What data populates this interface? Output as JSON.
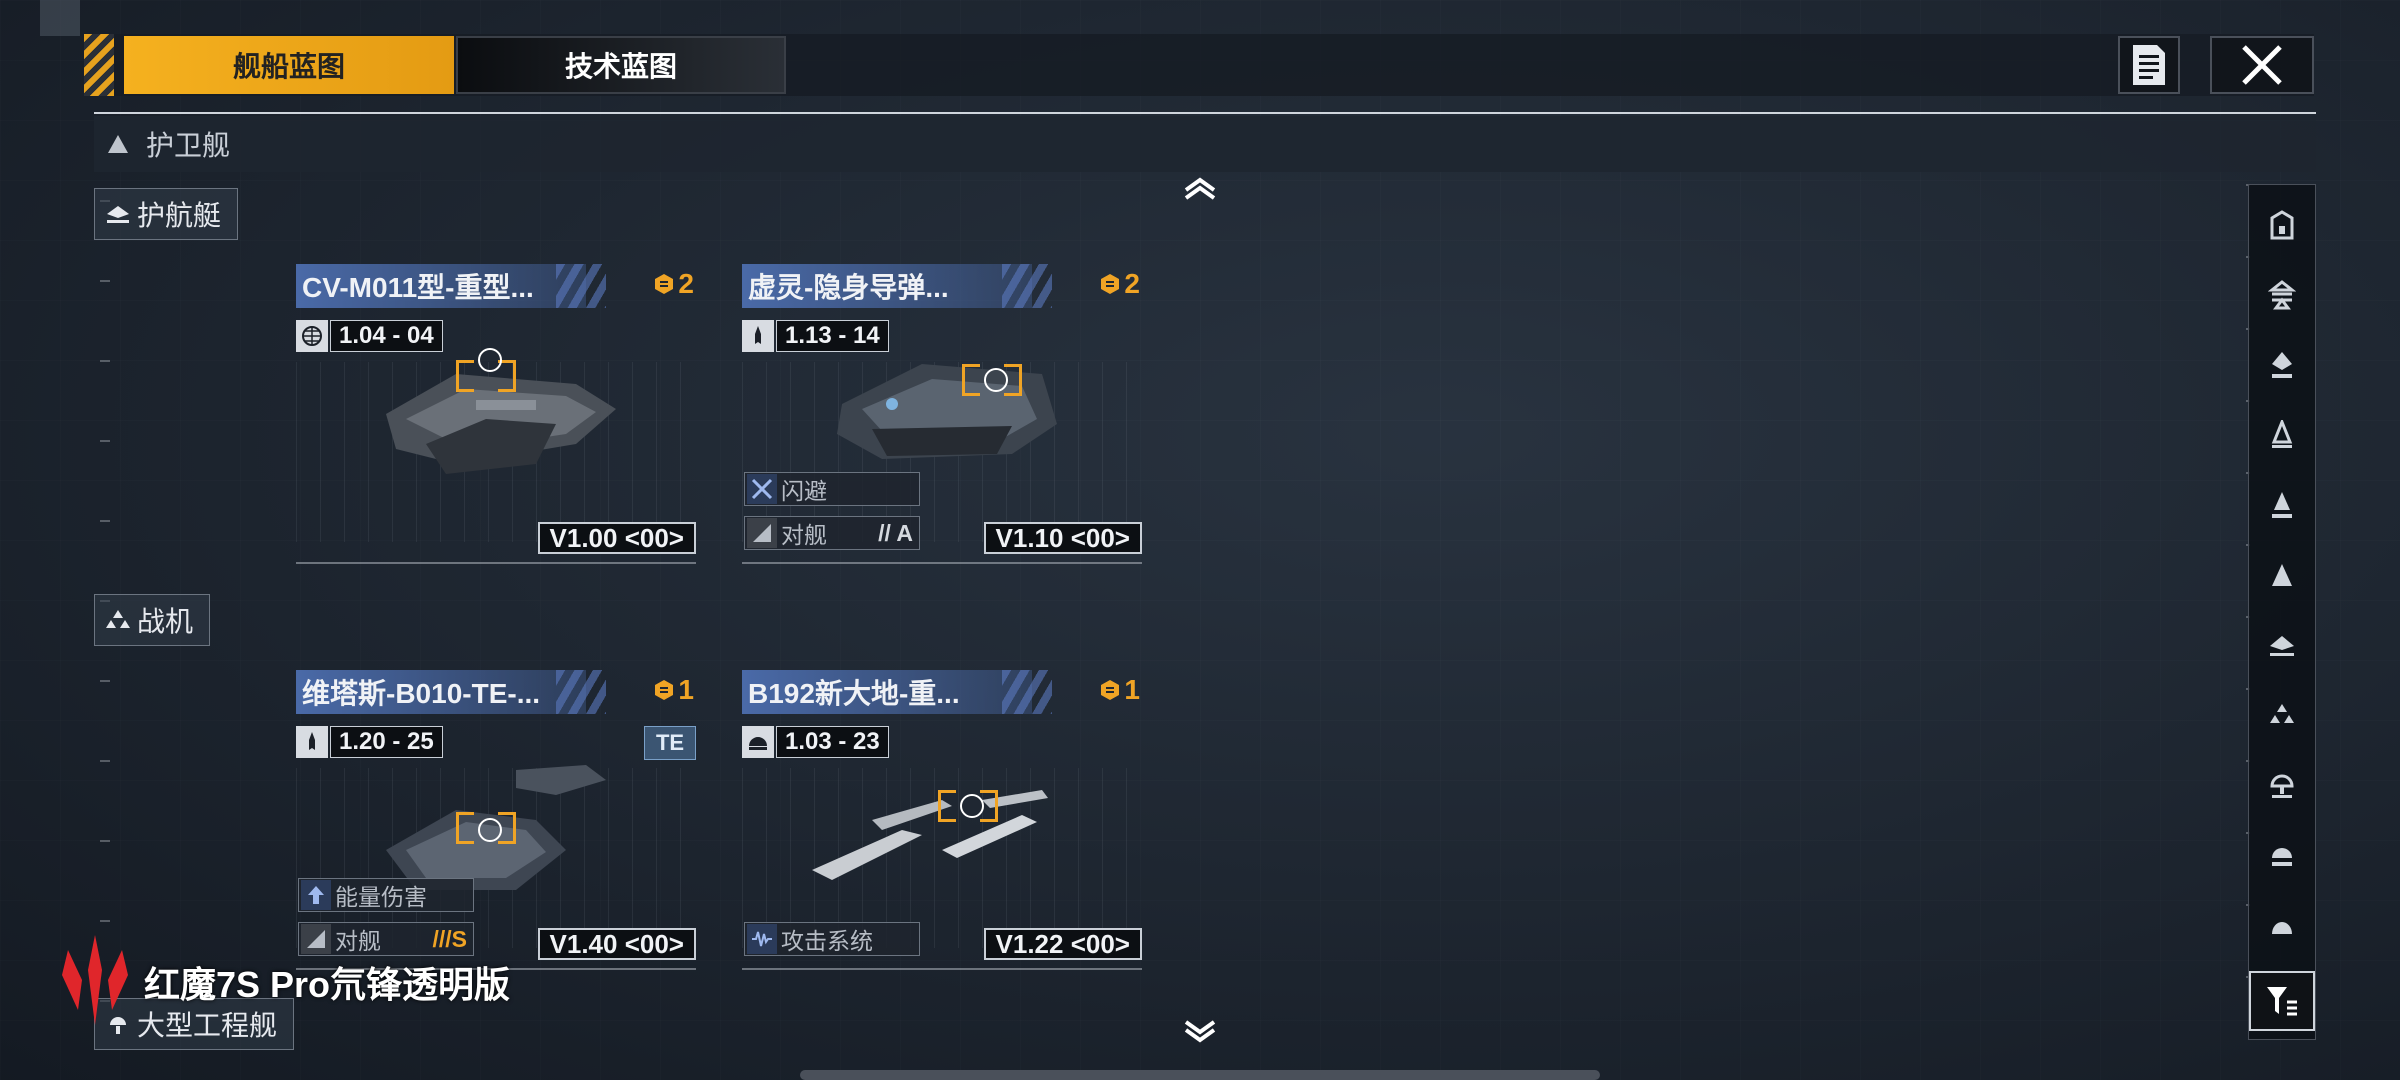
{
  "tabs": {
    "ship_blueprint": "舰船蓝图",
    "tech_blueprint": "技术蓝图"
  },
  "section": {
    "title": "护卫舰"
  },
  "categories": {
    "escort": "护航艇",
    "fighter": "战机",
    "engineering": "大型工程舰"
  },
  "cards": [
    {
      "title": "CV-M011型-重型...",
      "count": "2",
      "version": "1.04 - 04",
      "level": "V1.00 <00>",
      "tags": []
    },
    {
      "title": "虚灵-隐身导弹...",
      "count": "2",
      "version": "1.13 - 14",
      "level": "V1.10 <00>",
      "tags": [
        {
          "label": "闪避",
          "grade": ""
        },
        {
          "label": "对舰",
          "grade": "// A"
        }
      ]
    },
    {
      "title": "维塔斯-B010-TE-...",
      "count": "1",
      "version": "1.20 - 25",
      "level": "V1.40 <00>",
      "badge": "TE",
      "tags": [
        {
          "label": "能量伤害",
          "grade": ""
        },
        {
          "label": "对舰",
          "grade": "///S"
        }
      ]
    },
    {
      "title": "B192新大地-重...",
      "count": "1",
      "version": "1.03 - 23",
      "level": "V1.22 <00>",
      "tags": [
        {
          "label": "攻击系统",
          "grade": ""
        }
      ]
    }
  ],
  "watermark": {
    "text": "红魔7S Pro氘锋透明版"
  },
  "icons": {
    "doc": "document-icon",
    "close": "close-icon",
    "up": "chevron-up-icon",
    "down": "chevron-down-icon",
    "filter": "filter-icon"
  },
  "colors": {
    "accent": "#f0a425",
    "title_bar": "#4a6aa8",
    "tab_active": "#f5b11f"
  }
}
